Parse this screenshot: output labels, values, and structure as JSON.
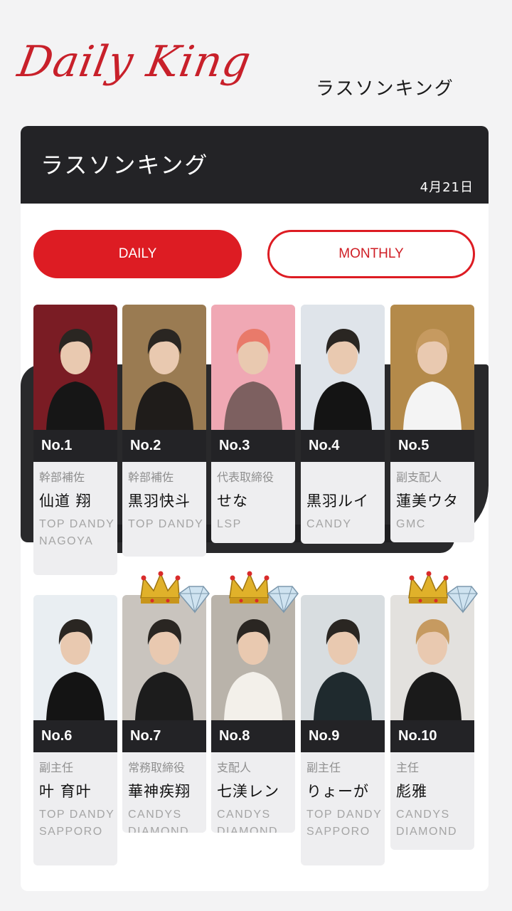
{
  "header": {
    "logo": "Daily King",
    "subtitle": "ラスソンキング"
  },
  "panel": {
    "title": "ラスソンキング",
    "date": "4月21日"
  },
  "tabs": {
    "daily": "DAILY",
    "monthly": "MONTHLY",
    "active": "DAILY"
  },
  "colors": {
    "accent": "#dd1c23",
    "dark": "#232326"
  },
  "rankings": [
    {
      "rank": "No.1",
      "role": "幹部補佐",
      "name": "仙道 翔",
      "store": "TOP DANDY NAGOYA",
      "crown": false,
      "photo_bg": "#7a1c24",
      "photo_fg": "#161616"
    },
    {
      "rank": "No.2",
      "role": "幹部補佐",
      "name": "黒羽快斗",
      "store": "TOP DANDY",
      "crown": false,
      "photo_bg": "#9a7b52",
      "photo_fg": "#1f1c1a"
    },
    {
      "rank": "No.3",
      "role": "代表取締役",
      "name": "せな",
      "store": "LSP",
      "crown": false,
      "photo_bg": "#f0a8b4",
      "photo_fg": "#7d6060"
    },
    {
      "rank": "No.4",
      "role": "",
      "name": "黒羽ルイ",
      "store": "CANDY",
      "crown": false,
      "photo_bg": "#dfe4ea",
      "photo_fg": "#141414"
    },
    {
      "rank": "No.5",
      "role": "副支配人",
      "name": "蓮美ウタ",
      "store": "GMC",
      "crown": false,
      "photo_bg": "#b48a4a",
      "photo_fg": "#f4f4f4"
    },
    {
      "rank": "No.6",
      "role": "副主任",
      "name": "叶 育叶",
      "store": "TOP DANDY SAPPORO",
      "crown": false,
      "photo_bg": "#e9eef2",
      "photo_fg": "#141414"
    },
    {
      "rank": "No.7",
      "role": "常務取締役",
      "name": "華神疾翔",
      "store": "CANDYS DIAMOND",
      "crown": true,
      "photo_bg": "#c9c4be",
      "photo_fg": "#1c1c1c"
    },
    {
      "rank": "No.8",
      "role": "支配人",
      "name": "七渼レン",
      "store": "CANDYS DIAMOND",
      "crown": true,
      "photo_bg": "#b9b3aa",
      "photo_fg": "#f3f0ea"
    },
    {
      "rank": "No.9",
      "role": "副主任",
      "name": "りょーが",
      "store": "TOP DANDY SAPPORO",
      "crown": false,
      "photo_bg": "#d8dde0",
      "photo_fg": "#1f2a2e"
    },
    {
      "rank": "No.10",
      "role": "主任",
      "name": "彪雅",
      "store": "CANDYS DIAMOND",
      "crown": true,
      "photo_bg": "#e3e1de",
      "photo_fg": "#1a1a1a"
    }
  ]
}
